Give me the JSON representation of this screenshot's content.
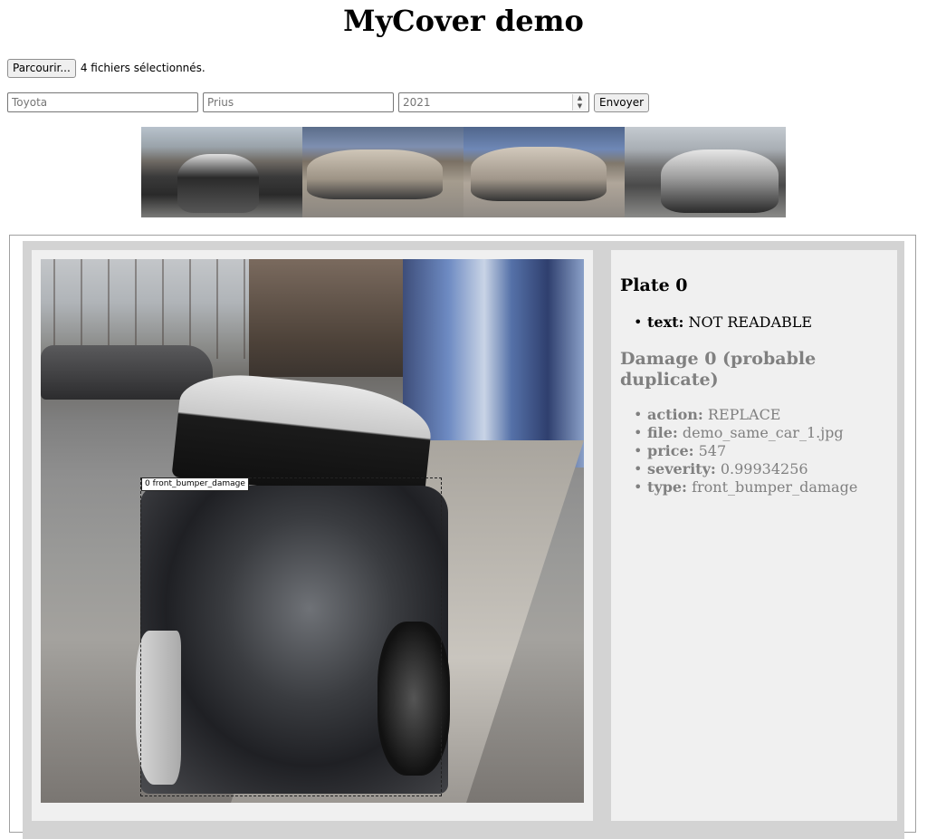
{
  "page": {
    "title": "MyCover demo"
  },
  "upload": {
    "browse_label": "Parcourir...",
    "status": "4 fichiers sélectionnés."
  },
  "form": {
    "make_placeholder": "Toyota",
    "model_placeholder": "Prius",
    "year_placeholder": "2021",
    "submit_label": "Envoyer"
  },
  "thumbnails": [
    {
      "alt": "car-photo-1"
    },
    {
      "alt": "car-photo-2"
    },
    {
      "alt": "car-photo-3"
    },
    {
      "alt": "car-photo-4"
    }
  ],
  "detection": {
    "box_label": "0 front_bumper_damage"
  },
  "plate": {
    "heading": "Plate 0",
    "text_label": "text:",
    "text_value": "NOT READABLE"
  },
  "damage": {
    "heading": "Damage 0 (probable duplicate)",
    "fields": [
      {
        "label": "action:",
        "value": "REPLACE"
      },
      {
        "label": "file:",
        "value": "demo_same_car_1.jpg"
      },
      {
        "label": "price:",
        "value": "547"
      },
      {
        "label": "severity:",
        "value": "0.99934256"
      },
      {
        "label": "type:",
        "value": "front_bumper_damage"
      }
    ]
  },
  "colors": {
    "panel_bg": "#d3d3d3",
    "card_bg": "#f0f0f0",
    "muted_text": "#808080"
  }
}
